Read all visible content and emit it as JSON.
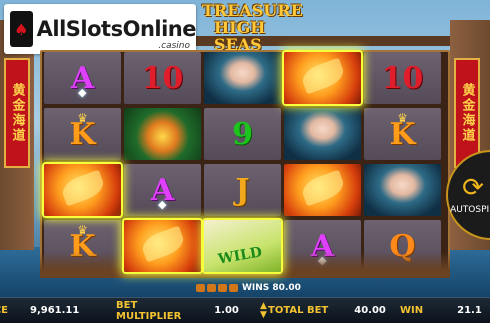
{
  "logo": {
    "brand": "AllSlotsOnline",
    "suffix": ".casino",
    "card_icon": "spade-card-icon"
  },
  "game": {
    "title_line1": "TREASURE",
    "title_line2": "HIGH SEAS"
  },
  "banners": {
    "left": "黄金海道",
    "right": "黄金海道"
  },
  "reels": [
    [
      {
        "sym": "A",
        "win": false
      },
      {
        "sym": "K",
        "win": false
      },
      {
        "sym": "phoenix",
        "win": true
      },
      {
        "sym": "K",
        "win": false
      }
    ],
    [
      {
        "sym": "10",
        "win": false
      },
      {
        "sym": "chest",
        "win": false
      },
      {
        "sym": "A",
        "win": false
      },
      {
        "sym": "phoenix",
        "win": true
      }
    ],
    [
      {
        "sym": "maiden",
        "win": false
      },
      {
        "sym": "9",
        "win": false
      },
      {
        "sym": "J",
        "win": false
      },
      {
        "sym": "wild",
        "win": true
      }
    ],
    [
      {
        "sym": "phoenix",
        "win": true
      },
      {
        "sym": "maiden",
        "win": false
      },
      {
        "sym": "phoenix",
        "win": false
      },
      {
        "sym": "A",
        "win": false
      }
    ],
    [
      {
        "sym": "10",
        "win": false
      },
      {
        "sym": "K",
        "win": false
      },
      {
        "sym": "maiden",
        "win": false
      },
      {
        "sym": "Q",
        "win": false
      }
    ]
  ],
  "wild_label": "WILD",
  "autospin_label": "AUTOSPIN",
  "win_line": {
    "text": "WINS 80.00"
  },
  "bottom_bar": {
    "balance_label": "BALANCE",
    "balance": "9,961.11",
    "multiplier_label": "BET MULTIPLIER",
    "multiplier": "1.00",
    "total_bet_label": "TOTAL BET",
    "total_bet": "40.00",
    "win_label": "WIN",
    "win": "21.1"
  },
  "colors": {
    "highlight": "#f8ff3c",
    "accent": "#f2c230",
    "banner": "#c0121b"
  }
}
